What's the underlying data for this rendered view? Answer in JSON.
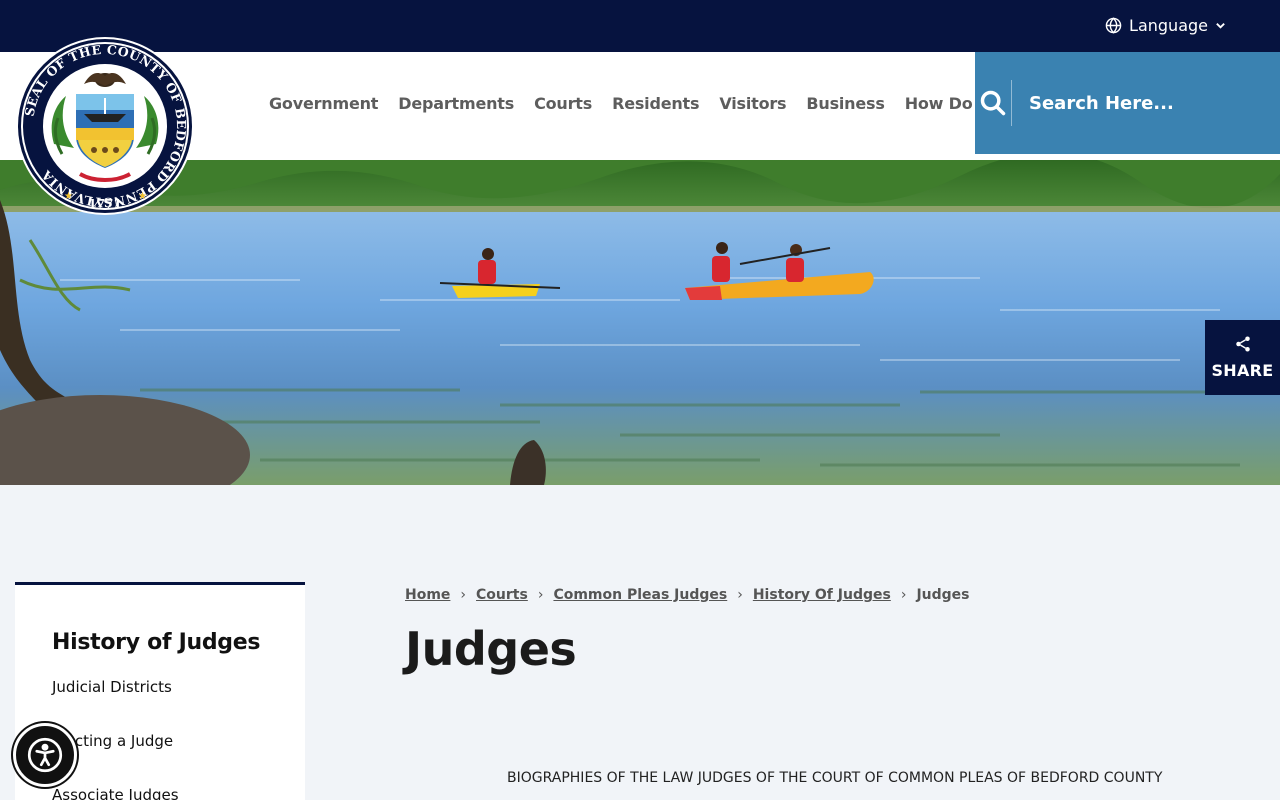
{
  "topbar": {
    "language_label": "Language"
  },
  "seal": {
    "alt": "Seal of the County of Bedford Pennsylvania",
    "ring_text": "SEAL OF THE COUNTY OF BEDFORD PENNSYLVANIA",
    "year": "1771"
  },
  "nav": {
    "items": [
      {
        "label": "Government"
      },
      {
        "label": "Departments"
      },
      {
        "label": "Courts"
      },
      {
        "label": "Residents"
      },
      {
        "label": "Visitors"
      },
      {
        "label": "Business"
      },
      {
        "label": "How Do I"
      }
    ]
  },
  "search": {
    "placeholder": "Search Here..."
  },
  "share": {
    "label": "SHARE"
  },
  "sidebar": {
    "title": "History of Judges",
    "items": [
      {
        "label": "Judicial Districts"
      },
      {
        "label": "Electing a Judge"
      },
      {
        "label": "Associate Judges"
      }
    ]
  },
  "breadcrumb": {
    "items": [
      {
        "label": "Home"
      },
      {
        "label": "Courts"
      },
      {
        "label": "Common Pleas Judges"
      },
      {
        "label": "History Of Judges"
      }
    ],
    "current": "Judges"
  },
  "page": {
    "title": "Judges",
    "intro": "BIOGRAPHIES OF THE LAW JUDGES OF THE COURT OF COMMON PLEAS OF BEDFORD COUNTY"
  },
  "colors": {
    "topbar": "#06133f",
    "search_bg": "#3a82b1",
    "page_bg": "#f1f4f8"
  }
}
